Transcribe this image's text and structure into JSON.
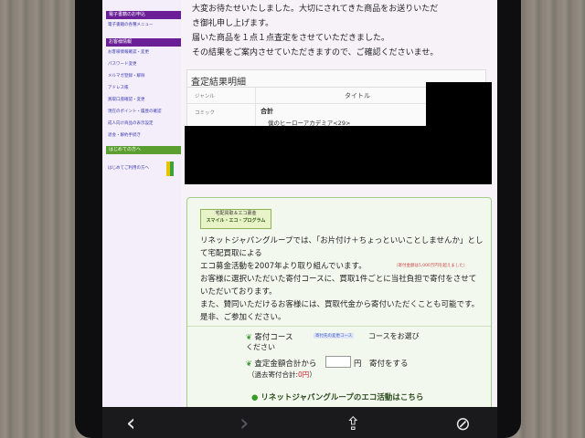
{
  "sidebar": {
    "section1": "電子書籍のお申込",
    "section1_link": "電子書籍の各種メニュー",
    "section2": "お客様情報",
    "links": [
      "お客様情報確認・変更",
      "パスワード変更",
      "メルマガ登録・解除",
      "アドレス帳",
      "買取口座確認・変更",
      "現在のポイント・履歴の確認",
      "成人向け商品の表示設定",
      "退会・解約手続き"
    ],
    "section3": "はじめての方へ",
    "beginner_link": "はじめてご利用の方へ"
  },
  "intro": {
    "line1": "大変お待たせいたしました。大切にされてきた商品をお送りいただ",
    "line2": "き御礼申し上げます。",
    "line3": "届いた商品を１点１点査定をさせていただきました。",
    "line4": "その結果をご案内させていただきますので、ご確認くださいませ。"
  },
  "assessment": {
    "title": "査定結果明細",
    "col_genre": "ジャンル",
    "col_title": "タイトル",
    "row1_genre": "コミック",
    "row1_total": "合計",
    "row1_item": "僕のヒーローアカデミア<29>"
  },
  "eco": {
    "logo_line1": "宅配買取＆エコ募金",
    "logo_line2": "スマイル・エコ・プログラム",
    "p1": "リネットジャパングループでは、「お片付け＋ちょっといいことしませんか」とし",
    "p2": "て宅配買取による",
    "p3": "エコ募金活動を2007年より取り組んでいます。",
    "p3_note": "（寄付金額は5,000万円を超えました）",
    "p4": "お客様に選択いただいた寄付コースに、買取1件ごとに当社負担で寄付をさせて",
    "p5": "いただいております。",
    "p6": "また、賛同いただけるお客様には、買取代金から寄付いただくことも可能です。",
    "p7": "是非、ご参加ください。",
    "course_label": "寄付コース",
    "course_select": "寄付先の変更コース",
    "course_suffix": "コースをお選び",
    "course_suffix2": "ください",
    "amount_label": "査定金額合計から",
    "amount_unit": "円　寄付をする",
    "history": "（過去寄付合計:",
    "history_value": "0円",
    "history_close": "）",
    "link": "リネットジャパングループのエコ活動はこちら"
  },
  "toolbar": {
    "back": "‹",
    "forward": "›",
    "share": "⇪",
    "compass": "⊘"
  }
}
